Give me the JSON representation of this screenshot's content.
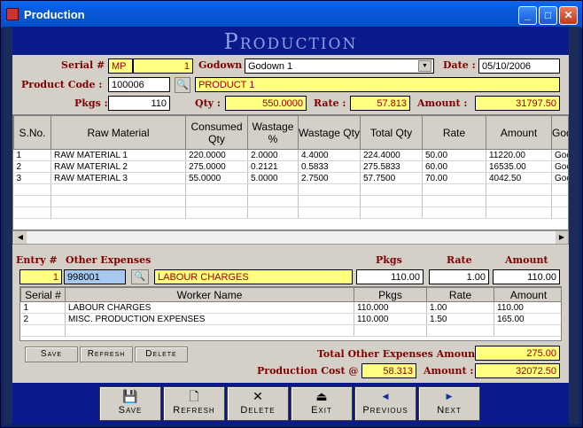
{
  "window": {
    "title": "Production"
  },
  "header": {
    "title": "Production"
  },
  "form": {
    "serial_label": "Serial #",
    "serial_prefix": "MP",
    "serial_no": "1",
    "godown_label": "Godown :",
    "godown_value": "Godown 1",
    "date_label": "Date :",
    "date_value": "05/10/2006",
    "product_code_label": "Product Code :",
    "product_code": "100006",
    "product_name": "PRODUCT 1",
    "pkgs_label": "Pkgs :",
    "pkgs": "110",
    "qty_label": "Qty :",
    "qty": "550.0000",
    "rate_label": "Rate :",
    "rate": "57.813",
    "amount_label": "Amount :",
    "amount": "31797.50"
  },
  "materials": {
    "columns": [
      "S.No.",
      "Raw Material",
      "Consumed Qty",
      "Wastage %",
      "Wastage Qty",
      "Total Qty",
      "Rate",
      "Amount",
      "Godov"
    ],
    "rows": [
      [
        "1",
        "RAW MATERIAL 1",
        "220.0000",
        "2.0000",
        "4.4000",
        "224.4000",
        "50.00",
        "11220.00",
        "Goc"
      ],
      [
        "2",
        "RAW MATERIAL 2",
        "275.0000",
        "0.2121",
        "0.5833",
        "275.5833",
        "60.00",
        "16535.00",
        "Goc"
      ],
      [
        "3",
        "RAW MATERIAL 3",
        "55.0000",
        "5.0000",
        "2.7500",
        "57.7500",
        "70.00",
        "4042.50",
        "Goc"
      ]
    ]
  },
  "expenses": {
    "entry_label": "Entry #",
    "other_label": "Other Expenses",
    "pkgs_label": "Pkgs",
    "rate_label": "Rate",
    "amount_label": "Amount",
    "entry_no": "1",
    "code": "998001",
    "name": "LABOUR CHARGES",
    "pkgs": "110.00",
    "rate": "1.00",
    "amount": "110.00",
    "columns": [
      "Serial #",
      "Worker Name",
      "Pkgs",
      "Rate",
      "Amount"
    ],
    "rows": [
      [
        "1",
        "LABOUR CHARGES",
        "110.000",
        "1.00",
        "110.00"
      ],
      [
        "2",
        "MISC. PRODUCTION EXPENSES",
        "110.000",
        "1.50",
        "165.00"
      ]
    ]
  },
  "small_buttons": {
    "save": "Save",
    "refresh": "Refresh",
    "delete": "Delete"
  },
  "totals": {
    "total_label": "Total Other Expenses Amount :",
    "total_value": "275.00",
    "cost_label": "Production Cost @ :",
    "cost_value": "58.313",
    "amount_label": "Amount :",
    "amount_value": "32072.50"
  },
  "toolbar": {
    "save": "Save",
    "refresh": "Refresh",
    "delete": "Delete",
    "exit": "Exit",
    "previous": "Previous",
    "next": "Next"
  }
}
